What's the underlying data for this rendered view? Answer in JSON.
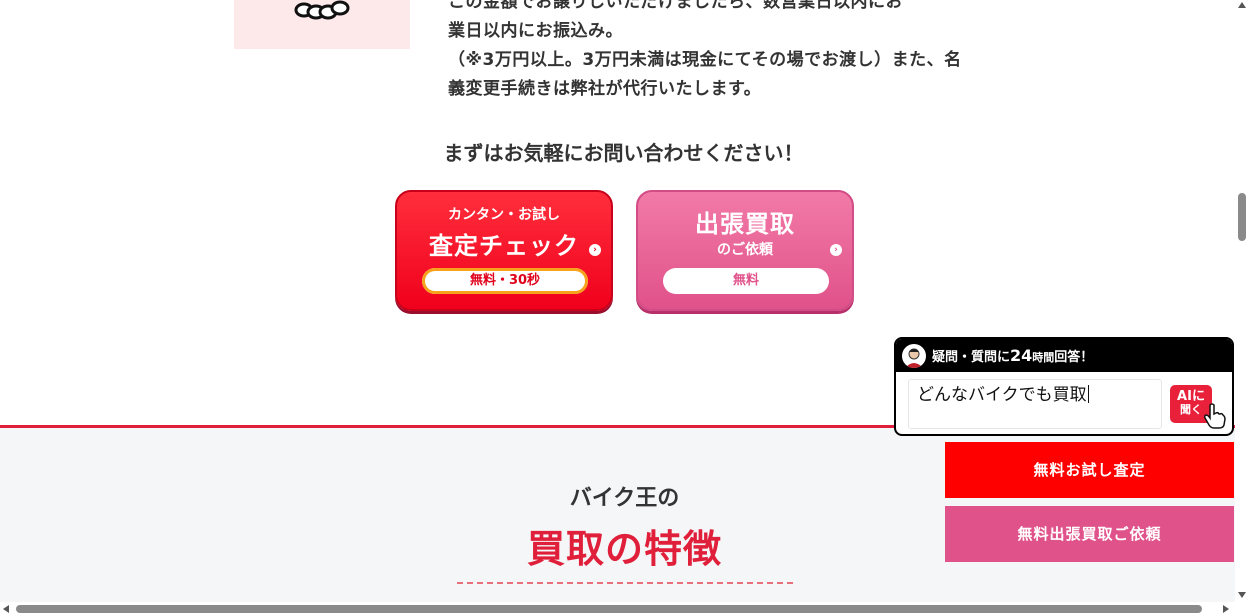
{
  "intro": {
    "lines": [
      "この金額でお譲りしいただけましたら、数営業日以内にお",
      "業日以内にお振込み。",
      "（※3万円以上。3万円未満は現金にてその場でお渡し）また、名",
      "義変更手続きは弊社が代行いたします。"
    ]
  },
  "cta": {
    "heading": "まずはお気軽にお問い合わせください！",
    "check_button": {
      "small": "カンタン・お試し",
      "large": "査定チェック",
      "pill": "無料・30秒"
    },
    "visit_button": {
      "large": "出張買取",
      "small": "のご依頼",
      "pill": "無料"
    }
  },
  "features": {
    "subtitle": "バイク王の",
    "title": "買取の特徴"
  },
  "chat": {
    "header_pre": "疑問・質問に",
    "header_num": "24",
    "header_mid": "時間",
    "header_post": "回答！",
    "input_text": "どんなバイクでも買取",
    "ai_label_1": "AIに",
    "ai_label_2": "聞く"
  },
  "side_buttons": {
    "trial": "無料お試し査定",
    "visit": "無料出張買取ご依頼"
  },
  "colors": {
    "brand_red": "#e0203a",
    "pink": "#e0528a",
    "side_red": "#ff0000"
  }
}
